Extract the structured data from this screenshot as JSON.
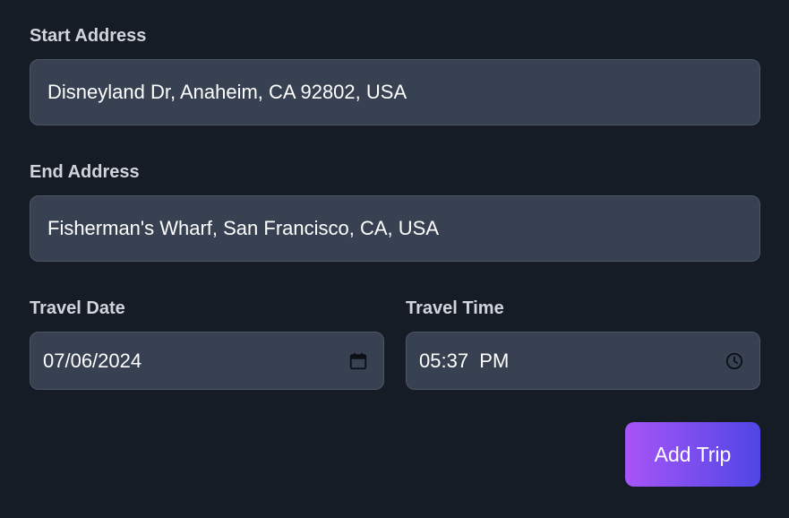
{
  "form": {
    "start_address": {
      "label": "Start Address",
      "value": "Disneyland Dr, Anaheim, CA 92802, USA"
    },
    "end_address": {
      "label": "End Address",
      "value": "Fisherman's Wharf, San Francisco, CA, USA"
    },
    "travel_date": {
      "label": "Travel Date",
      "value": "07/06/2024",
      "icon": "calendar-icon"
    },
    "travel_time": {
      "label": "Travel Time",
      "value": "05:37  PM",
      "icon": "clock-icon"
    },
    "submit_label": "Add Trip"
  },
  "colors": {
    "background": "#161c26",
    "field_bg": "#374151",
    "field_border": "#4b5563",
    "label_text": "#d1d5db",
    "button_gradient_start": "#a855f7",
    "button_gradient_end": "#4f46e5"
  }
}
